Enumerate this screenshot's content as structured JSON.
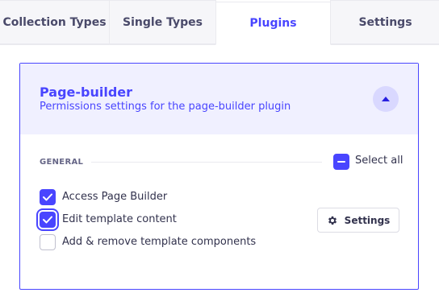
{
  "tabs": [
    {
      "label": "Collection Types",
      "active": false
    },
    {
      "label": "Single Types",
      "active": false
    },
    {
      "label": "Plugins",
      "active": true
    },
    {
      "label": "Settings",
      "active": false
    }
  ],
  "plugin": {
    "title": "Page-builder",
    "subtitle": "Permissions settings for the page-builder plugin",
    "expanded": true,
    "section_label": "GENERAL",
    "select_all_label": "Select all",
    "select_all_state": "indeterminate",
    "permissions": [
      {
        "label": "Access Page Builder",
        "checked": true
      },
      {
        "label": "Edit template content",
        "checked": true,
        "focused": true
      },
      {
        "label": "Add & remove template components",
        "checked": false
      }
    ],
    "settings_button_label": "Settings"
  },
  "colors": {
    "accent": "#4945ff",
    "header_bg": "#f0f0ff",
    "tab_bg": "#f6f6f9"
  },
  "icons": {
    "collapse": "chevron-up-icon",
    "settings": "gear-icon",
    "checkmark": "check-icon"
  }
}
